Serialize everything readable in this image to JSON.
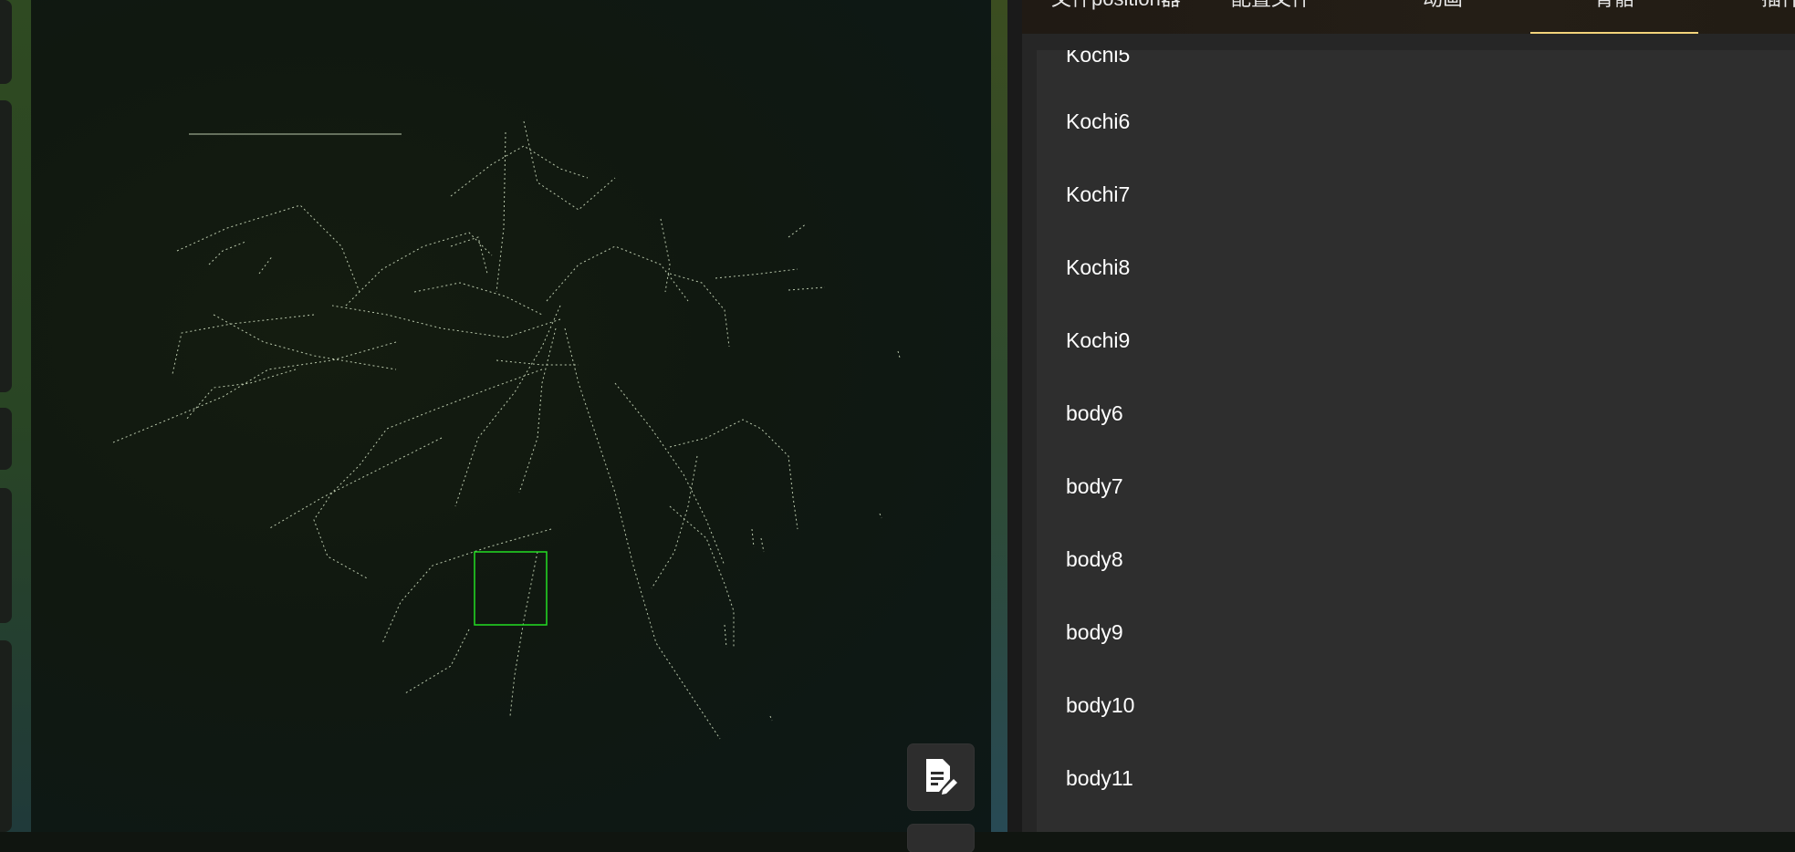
{
  "tabs": [
    {
      "label": "文件position器"
    },
    {
      "label": "配置文件"
    },
    {
      "label": "动画"
    },
    {
      "label": "骨骼",
      "active": true
    },
    {
      "label": "插件"
    }
  ],
  "bone_list": {
    "items": [
      {
        "label": "Kochi5"
      },
      {
        "label": "Kochi6"
      },
      {
        "label": "Kochi7"
      },
      {
        "label": "Kochi8"
      },
      {
        "label": "Kochi9"
      },
      {
        "label": "body6"
      },
      {
        "label": "body7"
      },
      {
        "label": "body8"
      },
      {
        "label": "body9"
      },
      {
        "label": "body10"
      },
      {
        "label": "body11"
      }
    ]
  },
  "viewport": {
    "selection_color": "#22dd22",
    "bone_color": "#d8e8c8"
  },
  "buttons": {
    "edit_icon": "document-edit-icon"
  }
}
